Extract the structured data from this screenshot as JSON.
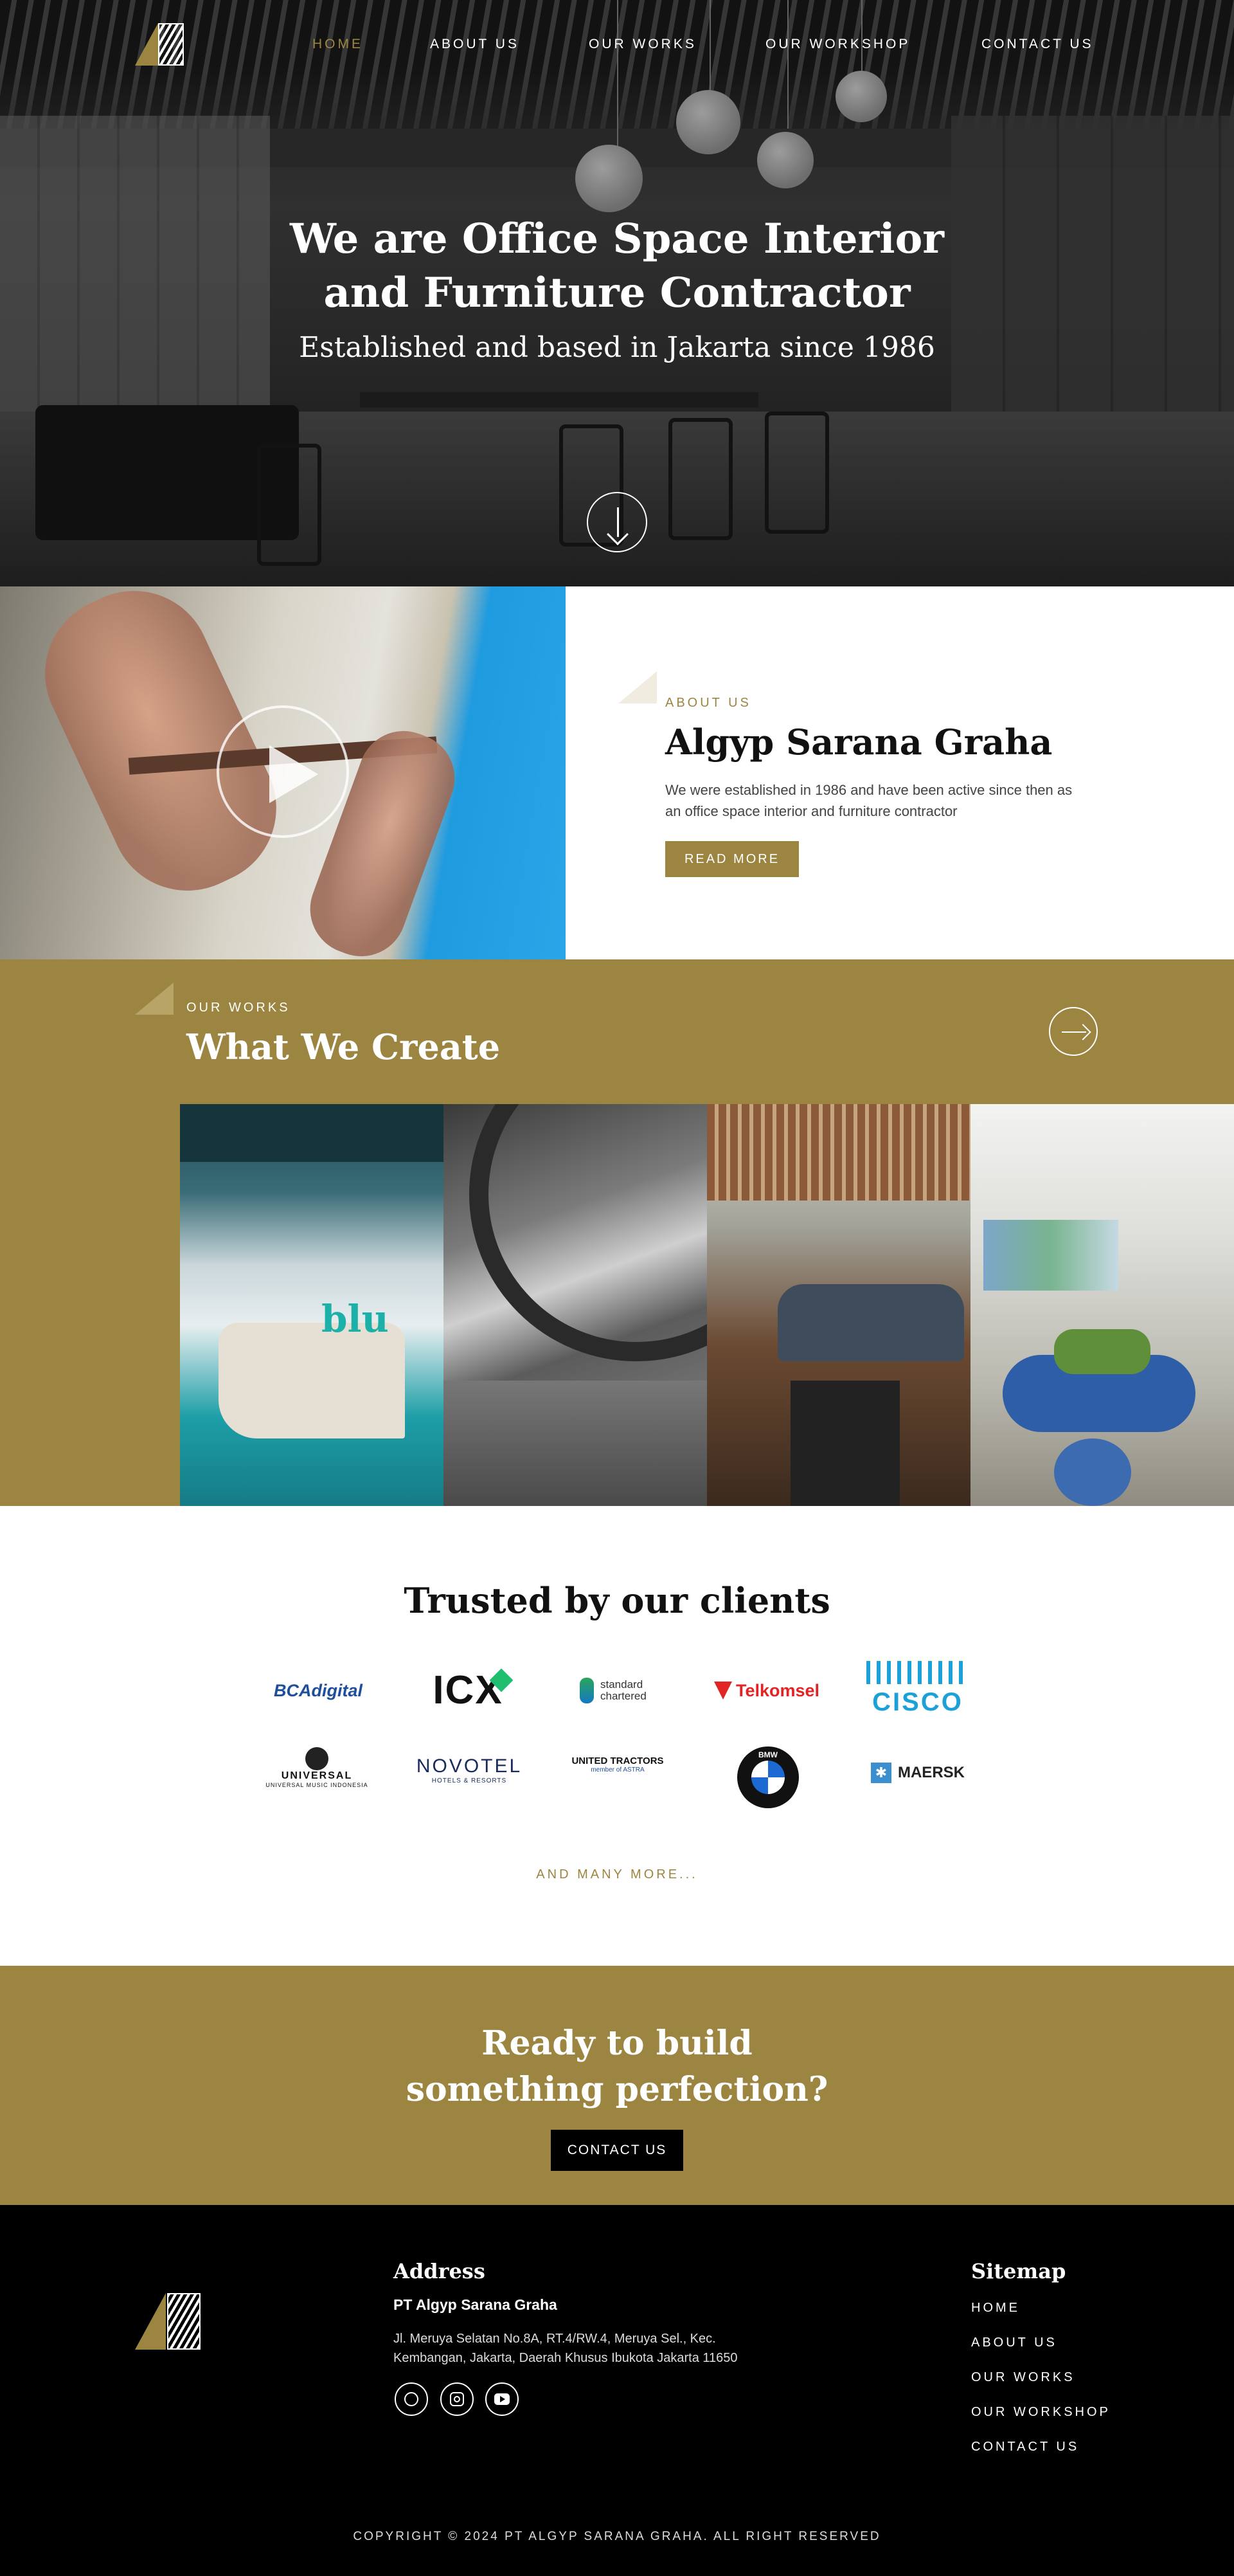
{
  "nav": {
    "links": [
      "HOME",
      "ABOUT US",
      "OUR WORKS",
      "OUR WORKSHOP",
      "CONTACT US"
    ],
    "active": "HOME",
    "accent_color": "#9c8540"
  },
  "hero": {
    "title_line1": "We are Office Space Interior",
    "title_line2": "and Furniture Contractor",
    "subtitle": "Established and based in Jakarta since 1986",
    "scroll_icon": "arrow-down-icon"
  },
  "about": {
    "eyebrow": "ABOUT US",
    "title": "Algyp Sarana Graha",
    "text": "We were established in 1986 and have been active since then as an office space interior and furniture contractor",
    "button": "READ MORE",
    "video_icon": "play-icon"
  },
  "works": {
    "eyebrow": "OUR WORKS",
    "title": "What We Create",
    "next_icon": "arrow-right-icon",
    "image1_text": "blu"
  },
  "clients": {
    "title": "Trusted by our clients",
    "logos": [
      "BCAdigital",
      "ICX",
      "standard chartered",
      "Telkomsel",
      "CISCO",
      "UNIVERSAL",
      "UNIVERSAL MUSIC INDONESIA",
      "NOVOTEL",
      "HOTELS & RESORTS",
      "UNITED TRACTORS",
      "member of ASTRA",
      "BMW",
      "MAERSK"
    ],
    "more": "AND MANY MORE..."
  },
  "cta": {
    "line1": "Ready to build",
    "line2": "something perfection?",
    "button": "CONTACT US"
  },
  "footer": {
    "address_heading": "Address",
    "company": "PT Algyp Sarana Graha",
    "address_line1": "Jl. Meruya Selatan No.8A, RT.4/RW.4, Meruya Sel., Kec.",
    "address_line2": "Kembangan, Jakarta, Daerah Khusus Ibukota Jakarta 11650",
    "social_icons": [
      "whatsapp-icon",
      "instagram-icon",
      "youtube-icon"
    ],
    "sitemap_heading": "Sitemap",
    "sitemap": [
      "HOME",
      "ABOUT US",
      "OUR WORKS",
      "OUR WORKSHOP",
      "CONTACT US"
    ],
    "copyright": "COPYRIGHT © 2024 PT ALGYP SARANA GRAHA. ALL RIGHT RESERVED"
  }
}
